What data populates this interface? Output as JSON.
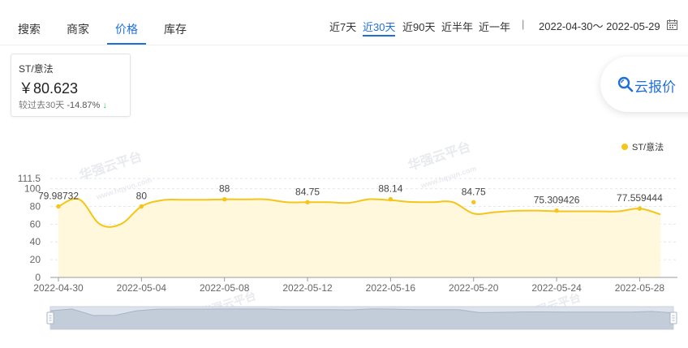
{
  "tabs": [
    {
      "label": "搜索"
    },
    {
      "label": "商家"
    },
    {
      "label": "价格"
    },
    {
      "label": "库存"
    }
  ],
  "active_tab": "价格",
  "ranges": [
    {
      "label": "近7天"
    },
    {
      "label": "近30天"
    },
    {
      "label": "近90天"
    },
    {
      "label": "近半年"
    },
    {
      "label": "近一年"
    }
  ],
  "active_range": "近30天",
  "separator": "|",
  "date_range": "2022-04-30～ 2022-05-29",
  "card": {
    "label": "ST/意法",
    "price": "￥80.623",
    "change_label": "较过去30天",
    "change_pct": "-14.87%",
    "arrow": "↓",
    "arrow_color": "#3bbf6a"
  },
  "cloud_button": {
    "label": "云报价",
    "icon": "search-icon"
  },
  "watermarks": [
    {
      "text": "华强云平台"
    },
    {
      "text": "www.hqyun.com"
    },
    {
      "text": "华强云平台"
    },
    {
      "text": "www.hqyun.com"
    },
    {
      "text": "华强云平台"
    },
    {
      "text": "华强云平台"
    }
  ],
  "chart_data": {
    "type": "area",
    "series": [
      {
        "name": "ST/意法",
        "color": "#f5c518",
        "values": [
          79.98732,
          88,
          60,
          60,
          80,
          87,
          87.5,
          87.5,
          88,
          88,
          88,
          84.75,
          84.75,
          84.75,
          84,
          88.14,
          87,
          85,
          84.75,
          84.75,
          72,
          73.5,
          75,
          75.309426,
          74.5,
          74.5,
          74.5,
          74.5,
          77.559444,
          71
        ]
      }
    ],
    "x": [
      "2022-04-30",
      "2022-05-01",
      "2022-05-02",
      "2022-05-03",
      "2022-05-04",
      "2022-05-05",
      "2022-05-06",
      "2022-05-07",
      "2022-05-08",
      "2022-05-09",
      "2022-05-10",
      "2022-05-11",
      "2022-05-12",
      "2022-05-13",
      "2022-05-14",
      "2022-05-15",
      "2022-05-16",
      "2022-05-17",
      "2022-05-18",
      "2022-05-19",
      "2022-05-20",
      "2022-05-21",
      "2022-05-22",
      "2022-05-23",
      "2022-05-24",
      "2022-05-25",
      "2022-05-26",
      "2022-05-27",
      "2022-05-28",
      "2022-05-29"
    ],
    "x_tick_labels": [
      "2022-04-30",
      "2022-05-04",
      "2022-05-08",
      "2022-05-12",
      "2022-05-16",
      "2022-05-20",
      "2022-05-24",
      "2022-05-28"
    ],
    "y_tick_labels": [
      "0",
      "20",
      "40",
      "60",
      "80",
      "100",
      "111.5"
    ],
    "ylim": [
      0,
      111.5
    ],
    "data_labels": [
      {
        "label": "79.98732",
        "x": "2022-04-30",
        "value": 79.98732
      },
      {
        "label": "80",
        "x": "2022-05-04",
        "value": 80
      },
      {
        "label": "88",
        "x": "2022-05-08",
        "value": 88
      },
      {
        "label": "84.75",
        "x": "2022-05-12",
        "value": 84.75
      },
      {
        "label": "88.14",
        "x": "2022-05-16",
        "value": 88.14
      },
      {
        "label": "84.75",
        "x": "2022-05-20",
        "value": 84.75
      },
      {
        "label": "75.309426",
        "x": "2022-05-24",
        "value": 75.309426
      },
      {
        "label": "77.559444",
        "x": "2022-05-28",
        "value": 77.559444
      }
    ],
    "grid": true,
    "legend": "top-right",
    "area_fill": "#fff8dc",
    "zoom_slider": true
  }
}
